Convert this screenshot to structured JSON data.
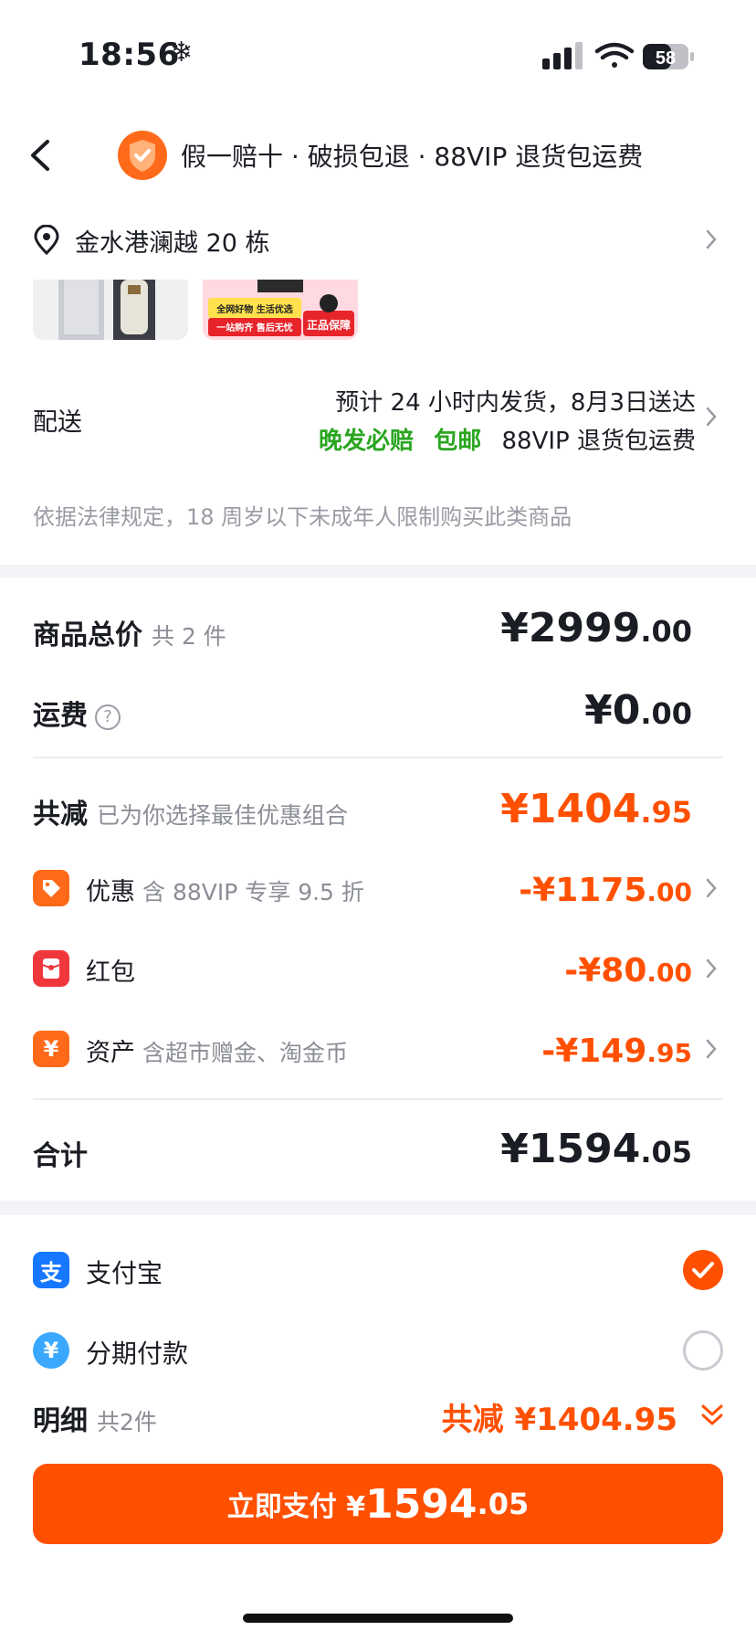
{
  "status_bar": {
    "time": "18:56",
    "weather_glyph": "❄",
    "battery": "58"
  },
  "header": {
    "guarantee": "假一赔十 · 破损包退 · 88VIP 退货包运费"
  },
  "address": {
    "text": "金水港澜越 20 栋"
  },
  "thumbnails": {
    "badge_top": "全网好物 生活优选",
    "badge_bottom": "一站购齐 售后无忧",
    "badge_right": "正品保障"
  },
  "delivery": {
    "label": "配送",
    "eta": "预计 24 小时内发货，8月3日送达",
    "tag_late": "晚发必赔",
    "tag_free": "包邮",
    "tag_vip": "88VIP 退货包运费"
  },
  "legal_notice": "依据法律规定，18 周岁以下未成年人限制购买此类商品",
  "price": {
    "goods_total_label": "商品总价",
    "goods_total_count": "共 2 件",
    "goods_total_int": "¥2999",
    "goods_total_dec": ".00",
    "shipping_label": "运费",
    "shipping_int": "¥0",
    "shipping_dec": ".00",
    "reduce_label": "共减",
    "reduce_sub": "已为你选择最佳优惠组合",
    "reduce_int": "¥1404",
    "reduce_dec": ".95",
    "items": [
      {
        "title": "优惠",
        "sub": "含 88VIP 专享 9.5 折",
        "int": "-¥1175",
        "dec": ".00"
      },
      {
        "title": "红包",
        "sub": "",
        "int": "-¥80",
        "dec": ".00"
      },
      {
        "title": "资产",
        "sub": "含超市赠金、淘金币",
        "int": "-¥149",
        "dec": ".95"
      }
    ],
    "total_label": "合计",
    "total_int": "¥1594",
    "total_dec": ".05"
  },
  "payment": {
    "alipay": "支付宝",
    "installment": "分期付款",
    "detail_label": "明细",
    "detail_count": "共2件",
    "detail_reduce": "共减 ¥1404.95",
    "pay_prefix": "立即支付 ¥",
    "pay_int": "1594",
    "pay_dec": ".05"
  },
  "colors": {
    "accent": "#ff5000",
    "green": "#2aa520",
    "alipay_blue": "#1677ff",
    "red_packet": "#f0383c"
  }
}
